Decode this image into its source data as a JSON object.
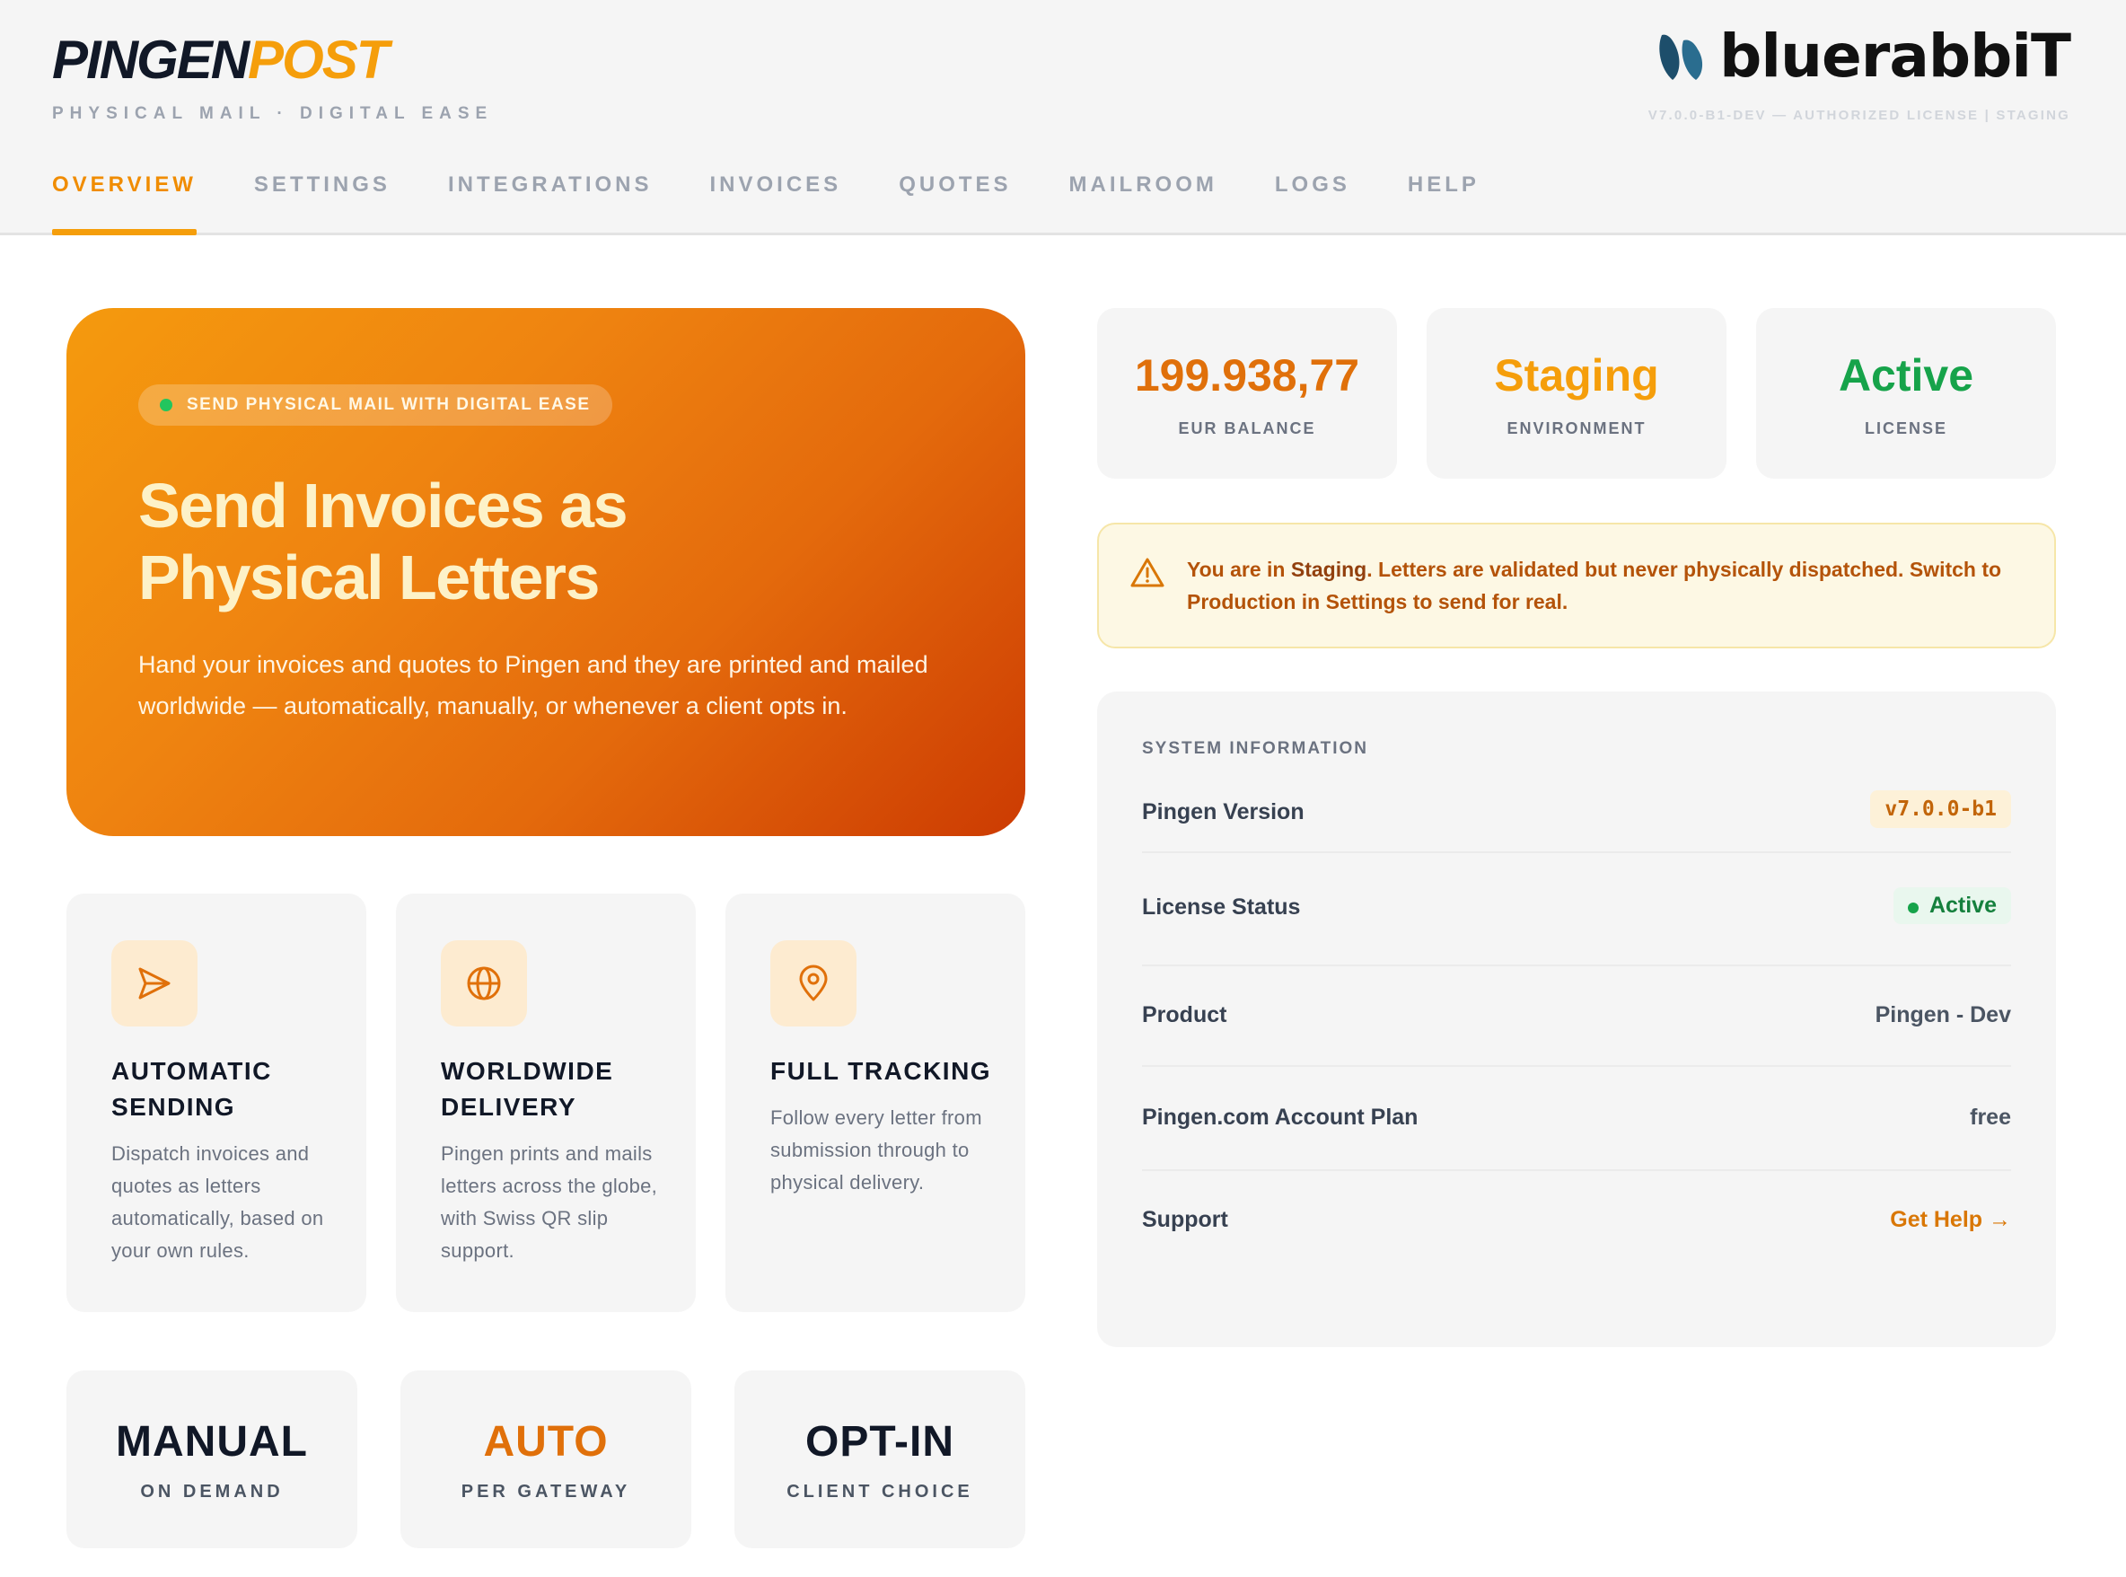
{
  "header": {
    "logo_part1": "PINGEN",
    "logo_part2": "POST",
    "tagline": "PHYSICAL MAIL · DIGITAL EASE",
    "brand": "bluerabbiT",
    "version_line": "V7.0.0-B1-DEV — AUTHORIZED LICENSE   | STAGING"
  },
  "nav": {
    "tabs": [
      {
        "label": "OVERVIEW",
        "active": true
      },
      {
        "label": "SETTINGS"
      },
      {
        "label": "INTEGRATIONS"
      },
      {
        "label": "INVOICES"
      },
      {
        "label": "QUOTES"
      },
      {
        "label": "MAILROOM"
      },
      {
        "label": "LOGS"
      },
      {
        "label": "HELP"
      }
    ]
  },
  "hero": {
    "pill": "SEND PHYSICAL MAIL WITH DIGITAL EASE",
    "title_line1": "Send Invoices as",
    "title_line2": "Physical Letters",
    "description": "Hand your invoices and quotes to Pingen and they are printed and mailed worldwide — automatically, manually, or whenever a client opts in."
  },
  "stats": [
    {
      "value": "199.938,77",
      "label": "EUR BALANCE",
      "color": "#e0700a"
    },
    {
      "value": "Staging",
      "label": "ENVIRONMENT",
      "color": "#f59e0b"
    },
    {
      "value": "Active",
      "label": "LICENSE",
      "color": "#16a34a"
    }
  ],
  "warning": {
    "prefix": "You are in ",
    "env": "Staging",
    "text": ". Letters are validated but never physically dispatched. Switch to Production in Settings to send for real."
  },
  "system": {
    "heading": "SYSTEM INFORMATION",
    "version_label": "Pingen Version",
    "version_value": "v7.0.0-b1",
    "license_label": "License Status",
    "license_value": "Active",
    "product_label": "Product",
    "product_value": "Pingen - Dev",
    "plan_label": "Pingen.com Account Plan",
    "plan_value": "free",
    "support_label": "Support",
    "support_link": "Get Help →"
  },
  "features": [
    {
      "icon": "send-icon",
      "title": "AUTOMATIC SENDING",
      "description": "Dispatch invoices and quotes as letters automatically, based on your own rules."
    },
    {
      "icon": "globe-icon",
      "title": "WORLDWIDE DELIVERY",
      "description": "Pingen prints and mails letters across the globe, with Swiss QR slip support."
    },
    {
      "icon": "location-pin-icon",
      "title": "FULL TRACKING",
      "description": "Follow every letter from submission through to physical delivery."
    }
  ],
  "modes": [
    {
      "value": "MANUAL",
      "label": "ON DEMAND",
      "color": "#111827"
    },
    {
      "value": "AUTO",
      "label": "PER GATEWAY",
      "color": "#e0700a"
    },
    {
      "value": "OPT-IN",
      "label": "CLIENT CHOICE",
      "color": "#111827"
    }
  ],
  "colors": {
    "accent": "#f59e0b",
    "hero_start": "#f59a0e",
    "hero_end": "#cc3b02",
    "warning_bg": "#fdf8e4"
  }
}
